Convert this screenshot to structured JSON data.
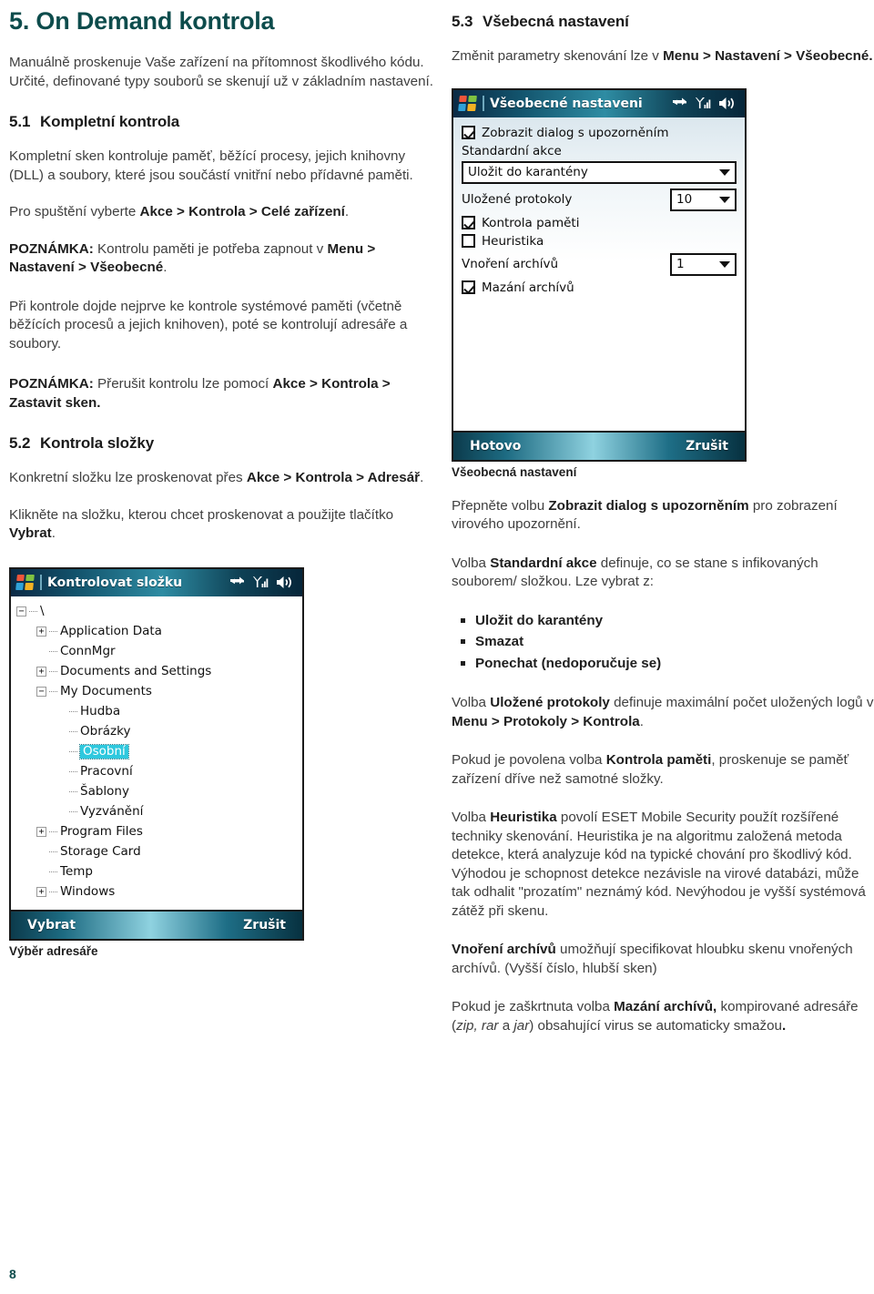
{
  "page_number": "8",
  "left_column": {
    "chapter_title": "5. On Demand kontrola",
    "intro": "Manuálně proskenuje Vaše zařízení na přítomnost škodlivého kódu. Určité, definované typy souborů se skenují už v základním nastavení.",
    "section_51": {
      "num": "5.1",
      "title": "Kompletní kontrola"
    },
    "p1": "Kompletní sken kontroluje paměť, běžící procesy, jejich knihovny (DLL) a soubory, které jsou součástí vnitřní nebo přídavné paměti.",
    "p2_pre": "Pro spuštění vyberte ",
    "p2_bold": "Akce > Kontrola > Celé zařízení",
    "p2_post": ".",
    "p3_bold1": "POZNÁMKA:",
    "p3_mid": " Kontrolu paměti je potřeba zapnout v ",
    "p3_bold2": "Menu > Nastavení > Všeobecné",
    "p3_post": ".",
    "p4": "Při kontrole dojde nejprve ke kontrole systémové paměti (včetně běžících procesů a jejich knihoven), poté se kontrolují adresáře a soubory.",
    "p5_bold1": "POZNÁMKA:",
    "p5_mid": " Přerušit kontrolu lze pomocí ",
    "p5_bold2": "Akce > Kontrola > Zastavit sken.",
    "section_52": {
      "num": "5.2",
      "title": "Kontrola složky"
    },
    "p6_pre": "Konkretní složku lze proskenovat přes ",
    "p6_bold": "Akce > Kontrola > Adresář",
    "p6_post": ".",
    "p7_pre": "Klikněte na složku, kterou chcet proskenovat a použijte tlačítko ",
    "p7_bold": "Vybrat",
    "p7_post": "."
  },
  "folder_screenshot": {
    "title": "Kontrolovat složku",
    "caption": "Výběr adresáře",
    "softkeys": {
      "left": "Vybrat",
      "right": "Zrušit"
    },
    "tree": [
      {
        "label": "\\",
        "depth": 0,
        "toggle": "minus",
        "selected": false
      },
      {
        "label": "Application Data",
        "depth": 1,
        "toggle": "plus",
        "selected": false
      },
      {
        "label": "ConnMgr",
        "depth": 1,
        "toggle": "none",
        "selected": false
      },
      {
        "label": "Documents and Settings",
        "depth": 1,
        "toggle": "plus",
        "selected": false
      },
      {
        "label": "My Documents",
        "depth": 1,
        "toggle": "minus",
        "selected": false
      },
      {
        "label": "Hudba",
        "depth": 2,
        "toggle": "none",
        "selected": false
      },
      {
        "label": "Obrázky",
        "depth": 2,
        "toggle": "none",
        "selected": false
      },
      {
        "label": "Osobní",
        "depth": 2,
        "toggle": "none",
        "selected": true
      },
      {
        "label": "Pracovní",
        "depth": 2,
        "toggle": "none",
        "selected": false
      },
      {
        "label": "Šablony",
        "depth": 2,
        "toggle": "none",
        "selected": false
      },
      {
        "label": "Vyzvánění",
        "depth": 2,
        "toggle": "none",
        "selected": false
      },
      {
        "label": "Program Files",
        "depth": 1,
        "toggle": "plus",
        "selected": false
      },
      {
        "label": "Storage Card",
        "depth": 1,
        "toggle": "none",
        "selected": false
      },
      {
        "label": "Temp",
        "depth": 1,
        "toggle": "none",
        "selected": false
      },
      {
        "label": "Windows",
        "depth": 1,
        "toggle": "plus",
        "selected": false
      }
    ],
    "icons": [
      "windows-logo-icon",
      "connectivity-icon",
      "signal-icon",
      "volume-icon"
    ],
    "selection_color": "#2ec8de"
  },
  "settings_screenshot": {
    "title": "Všeobecné nastaveni",
    "caption": "Všeobecná nastavení",
    "softkeys": {
      "left": "Hotovo",
      "right": "Zrušit"
    },
    "fields": {
      "show_alert_dialog": {
        "label": "Zobrazit dialog s upozorněním",
        "checked": true
      },
      "default_action_label": "Standardní akce",
      "default_action_value": "Uložit do karantény",
      "saved_logs_label": "Uložené protokoly",
      "saved_logs_value": "10",
      "memory_scan": {
        "label": "Kontrola paměti",
        "checked": true
      },
      "heuristics": {
        "label": "Heuristika",
        "checked": false
      },
      "archive_nesting_label": "Vnoření archívů",
      "archive_nesting_value": "1",
      "delete_archives": {
        "label": "Mazání archívů",
        "checked": true
      }
    },
    "icons": [
      "windows-logo-icon",
      "connectivity-icon",
      "signal-icon",
      "volume-icon"
    ]
  },
  "right_column": {
    "section_53": {
      "num": "5.3",
      "title": "Všebecná nastavení"
    },
    "p1_pre": "Změnit parametry skenování lze v ",
    "p1_bold": "Menu > Nastavení > Všeobecné.",
    "p2_pre": "Přepněte volbu ",
    "p2_bold": "Zobrazit dialog s upozorněním",
    "p2_post": " pro zobrazení virového upozornění.",
    "p3_pre": "Volba ",
    "p3_bold": "Standardní akce",
    "p3_post": " definuje, co se stane s infikovaných souborem/ složkou. Lze vybrat z:",
    "bullets": [
      "Uložit do karantény",
      "Smazat",
      " Ponechat (nedoporučuje se)"
    ],
    "p4_pre": "Volba ",
    "p4_bold": "Uložené protokoly",
    "p4_mid": " definuje maximální počet uložených logů v ",
    "p4_bold2": "Menu > Protokoly > Kontrola",
    "p4_post": ".",
    "p5_pre": "Pokud je povolena volba ",
    "p5_bold": "Kontrola paměti",
    "p5_post": ", proskenuje se paměť zařízení dříve než samotné složky.",
    "p6_pre": "Volba ",
    "p6_bold": "Heuristika",
    "p6_post": " povolí ESET Mobile Security použít rozšířené techniky skenování. Heuristika je na algoritmu založená metoda detekce, která analyzuje kód na typické chování pro škodlivý kód. Výhodou je schopnost detekce nezávisle na virové databázi, může tak odhalit \"prozatím\" neznámý kód. Nevýhodou je vyšší systémová zátěž při skenu.",
    "p7_bold": "Vnoření archívů",
    "p7_post": " umožňují specifikovat hloubku skenu vnořených archívů. (Vyšší číslo, hlubší sken)",
    "p8_pre": "Pokud je zaškrtnuta volba ",
    "p8_bold": "Mazání archívů,",
    "p8_mid": " kompirované adresáře (",
    "p8_italic": "zip, rar",
    "p8_mid2": " a ",
    "p8_italic2": "jar",
    "p8_post": ")  obsahující virus se automaticky smažou",
    "p8_end": "."
  },
  "colors": {
    "chapter_heading": "#0d4c4c",
    "body_text": "#3f3f3f",
    "bold_text": "#1e1e1e",
    "titlebar_gradient_dark": "#0b2a45",
    "titlebar_gradient_teal": "#2e8ca3"
  }
}
